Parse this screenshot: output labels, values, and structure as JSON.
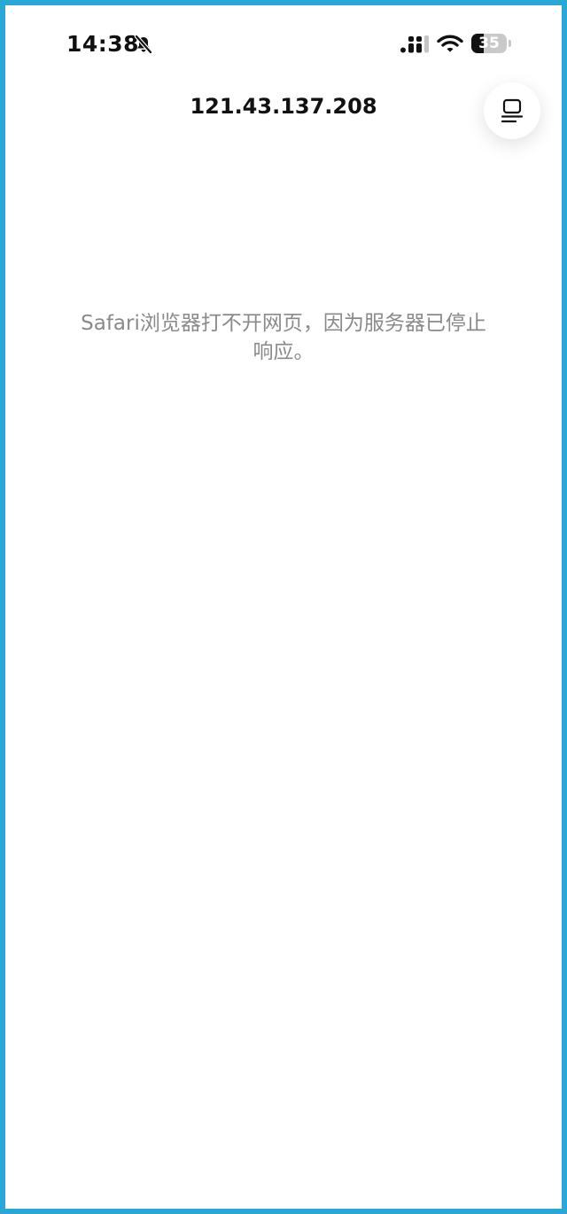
{
  "status_bar": {
    "time": "14:38",
    "mute_icon": "bell-slash-icon",
    "signal_icon": "cellular-signal-icon",
    "wifi_icon": "wifi-icon",
    "battery_level": "35",
    "battery_fraction": 0.35
  },
  "header": {
    "url": "121.43.137.208",
    "reader_button_icon": "reader-mode-icon"
  },
  "main": {
    "error_message": "Safari浏览器打不开网页，因为服务器已停止响应。"
  },
  "colors": {
    "border": "#29a8d8",
    "background": "#ffffff",
    "message_text": "#8a8a8a",
    "title_text": "#111111"
  }
}
